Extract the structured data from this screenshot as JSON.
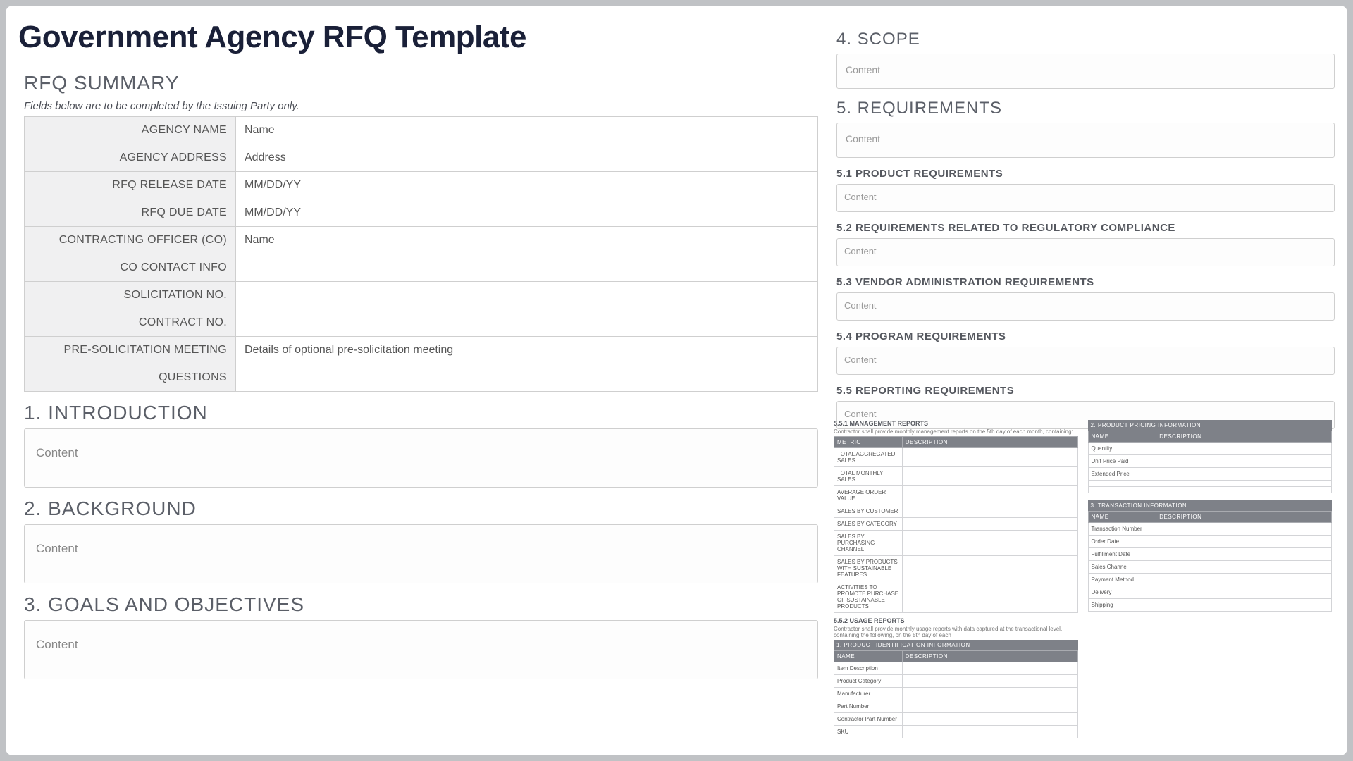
{
  "title": "Government Agency RFQ Template",
  "summary_heading": "RFQ SUMMARY",
  "summary_note": "Fields below are to be completed by the Issuing Party only.",
  "summary_rows": [
    {
      "label": "AGENCY NAME",
      "value": "Name"
    },
    {
      "label": "AGENCY ADDRESS",
      "value": "Address"
    },
    {
      "label": "RFQ RELEASE DATE",
      "value": "MM/DD/YY"
    },
    {
      "label": "RFQ DUE DATE",
      "value": "MM/DD/YY"
    },
    {
      "label": "CONTRACTING OFFICER (CO)",
      "value": "Name"
    },
    {
      "label": "CO CONTACT INFO",
      "value": ""
    },
    {
      "label": "SOLICITATION NO.",
      "value": ""
    },
    {
      "label": "CONTRACT NO.",
      "value": ""
    },
    {
      "label": "PRE-SOLICITATION MEETING",
      "value": "Details of optional pre-solicitation meeting"
    },
    {
      "label": "QUESTIONS",
      "value": ""
    }
  ],
  "left_sections": [
    {
      "heading": "1. INTRODUCTION",
      "content": "Content"
    },
    {
      "heading": "2. BACKGROUND",
      "content": "Content"
    },
    {
      "heading": "3. GOALS AND OBJECTIVES",
      "content": "Content"
    }
  ],
  "right_sections": {
    "scope": {
      "heading": "4. SCOPE",
      "content": "Content"
    },
    "requirements": {
      "heading": "5. REQUIREMENTS",
      "content": "Content",
      "subs": [
        {
          "heading": "5.1 PRODUCT REQUIREMENTS",
          "content": "Content"
        },
        {
          "heading": "5.2 REQUIREMENTS RELATED TO REGULATORY COMPLIANCE",
          "content": "Content"
        },
        {
          "heading": "5.3 VENDOR ADMINISTRATION REQUIREMENTS",
          "content": "Content"
        },
        {
          "heading": "5.4 PROGRAM REQUIREMENTS",
          "content": "Content"
        },
        {
          "heading": "5.5 REPORTING REQUIREMENTS",
          "content": "Content"
        }
      ]
    }
  },
  "thumbs": {
    "mgmt": {
      "caption": "5.5.1 MANAGEMENT REPORTS",
      "note": "Contractor shall provide monthly management reports on the 5th day of each month, containing:",
      "headers": [
        "METRIC",
        "DESCRIPTION"
      ],
      "rows": [
        "TOTAL AGGREGATED SALES",
        "TOTAL MONTHLY SALES",
        "AVERAGE ORDER VALUE",
        "SALES BY CUSTOMER",
        "SALES BY CATEGORY",
        "SALES BY PURCHASING CHANNEL",
        "SALES BY PRODUCTS WITH SUSTAINABLE FEATURES",
        "ACTIVITIES TO PROMOTE PURCHASE OF SUSTAINABLE PRODUCTS"
      ]
    },
    "usage": {
      "caption": "5.5.2 USAGE REPORTS",
      "note": "Contractor shall provide monthly usage reports with data captured at the transactional level, containing the following, on the 5th day of each",
      "header_bar": "1. PRODUCT IDENTIFICATION INFORMATION",
      "headers": [
        "NAME",
        "DESCRIPTION"
      ],
      "rows": [
        "Item Description",
        "Product Category",
        "Manufacturer",
        "Part Number",
        "Contractor Part Number",
        "SKU"
      ]
    },
    "pricing": {
      "header_bar": "2. PRODUCT PRICING INFORMATION",
      "headers": [
        "NAME",
        "DESCRIPTION"
      ],
      "rows": [
        "Quantity",
        "Unit Price Paid",
        "Extended Price",
        "",
        ""
      ]
    },
    "trans": {
      "header_bar": "3. TRANSACTION INFORMATION",
      "headers": [
        "NAME",
        "DESCRIPTION"
      ],
      "rows": [
        "Transaction Number",
        "Order Date",
        "Fulfillment Date",
        "Sales Channel",
        "Payment Method",
        "Delivery",
        "Shipping"
      ]
    }
  }
}
